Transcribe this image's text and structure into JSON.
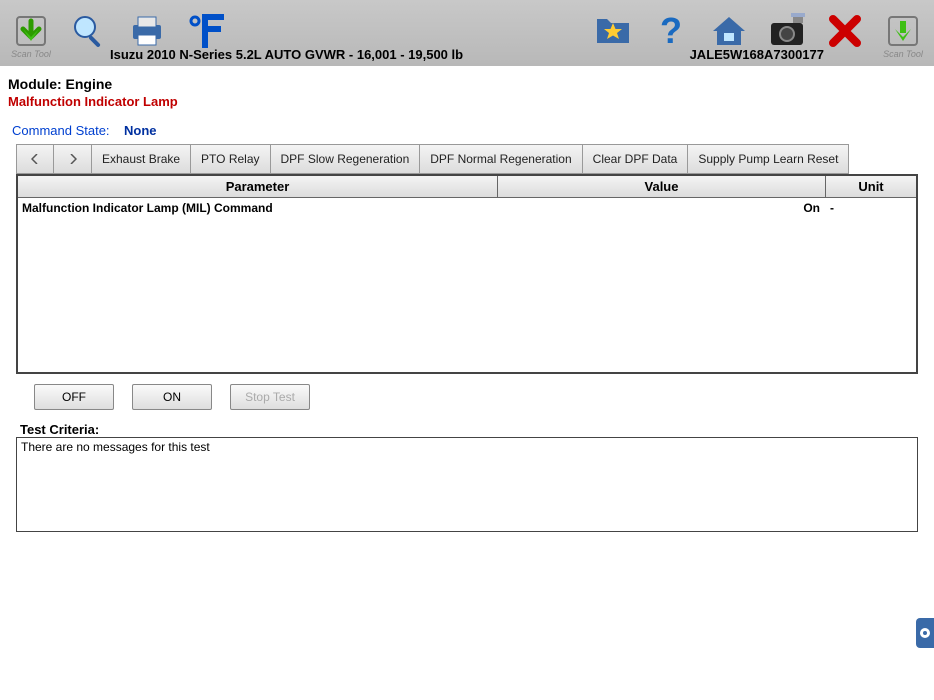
{
  "toolbar": {
    "scan_tool_left_label": "Scan Tool",
    "scan_tool_right_label": "Scan Tool",
    "vehicle_info": "Isuzu  2010  N-Series  5.2L  AUTO GVWR - 16,001 - 19,500 lb",
    "vin": "JALE5W168A7300177"
  },
  "module": {
    "label": "Module: Engine",
    "sub": "Malfunction Indicator Lamp"
  },
  "command_state": {
    "label": "Command State:",
    "value": "None"
  },
  "tabs": [
    "Exhaust Brake",
    "PTO Relay",
    "DPF Slow Regeneration",
    "DPF Normal Regeneration",
    "Clear DPF Data",
    "Supply Pump Learn Reset"
  ],
  "table": {
    "headers": {
      "param": "Parameter",
      "value": "Value",
      "unit": "Unit"
    },
    "rows": [
      {
        "param": "Malfunction Indicator Lamp (MIL) Command",
        "value": "On",
        "unit": "-"
      }
    ]
  },
  "controls": {
    "off": "OFF",
    "on": "ON",
    "stop": "Stop Test"
  },
  "criteria": {
    "label": "Test Criteria:",
    "message": "There are no messages for this test"
  }
}
